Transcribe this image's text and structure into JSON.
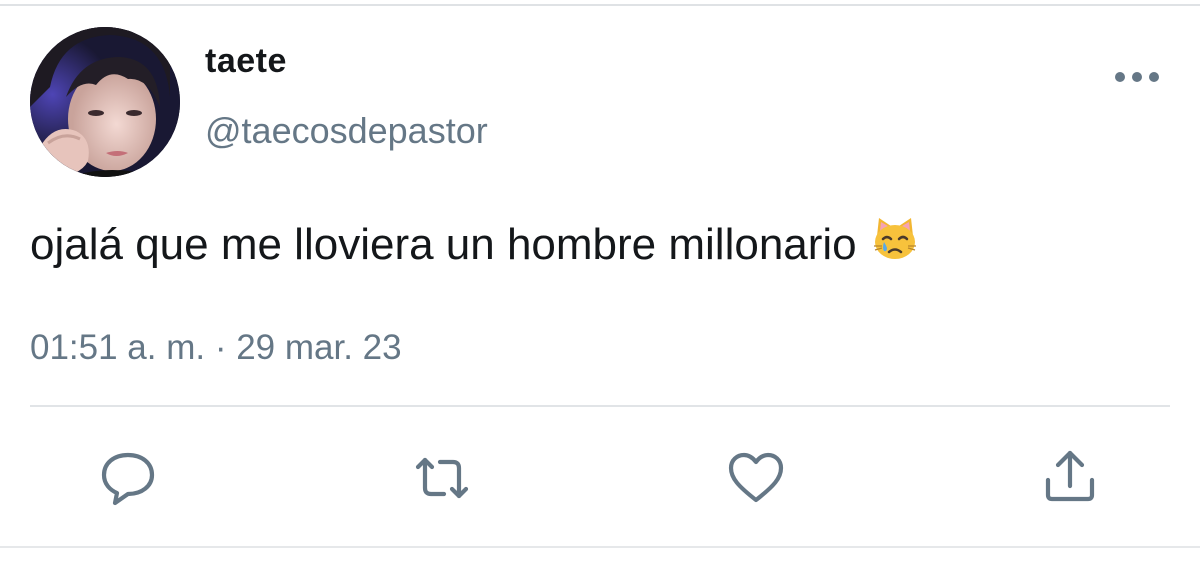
{
  "tweet": {
    "display_name": "taete",
    "handle": "@taecosdepastor",
    "text": "ojalá que me lloviera un hombre millonario",
    "emoji": "crying-cat-face",
    "time": "01:51 a. m.",
    "separator": " · ",
    "date": "29 mar. 23"
  },
  "actions": [
    {
      "name": "reply",
      "icon": "reply-icon"
    },
    {
      "name": "retweet",
      "icon": "retweet-icon"
    },
    {
      "name": "like",
      "icon": "heart-icon"
    },
    {
      "name": "share",
      "icon": "share-icon"
    }
  ],
  "colors": {
    "text_primary": "#14171a",
    "text_secondary": "#657786",
    "icon": "#657786",
    "divider": "#e1e4e7"
  }
}
